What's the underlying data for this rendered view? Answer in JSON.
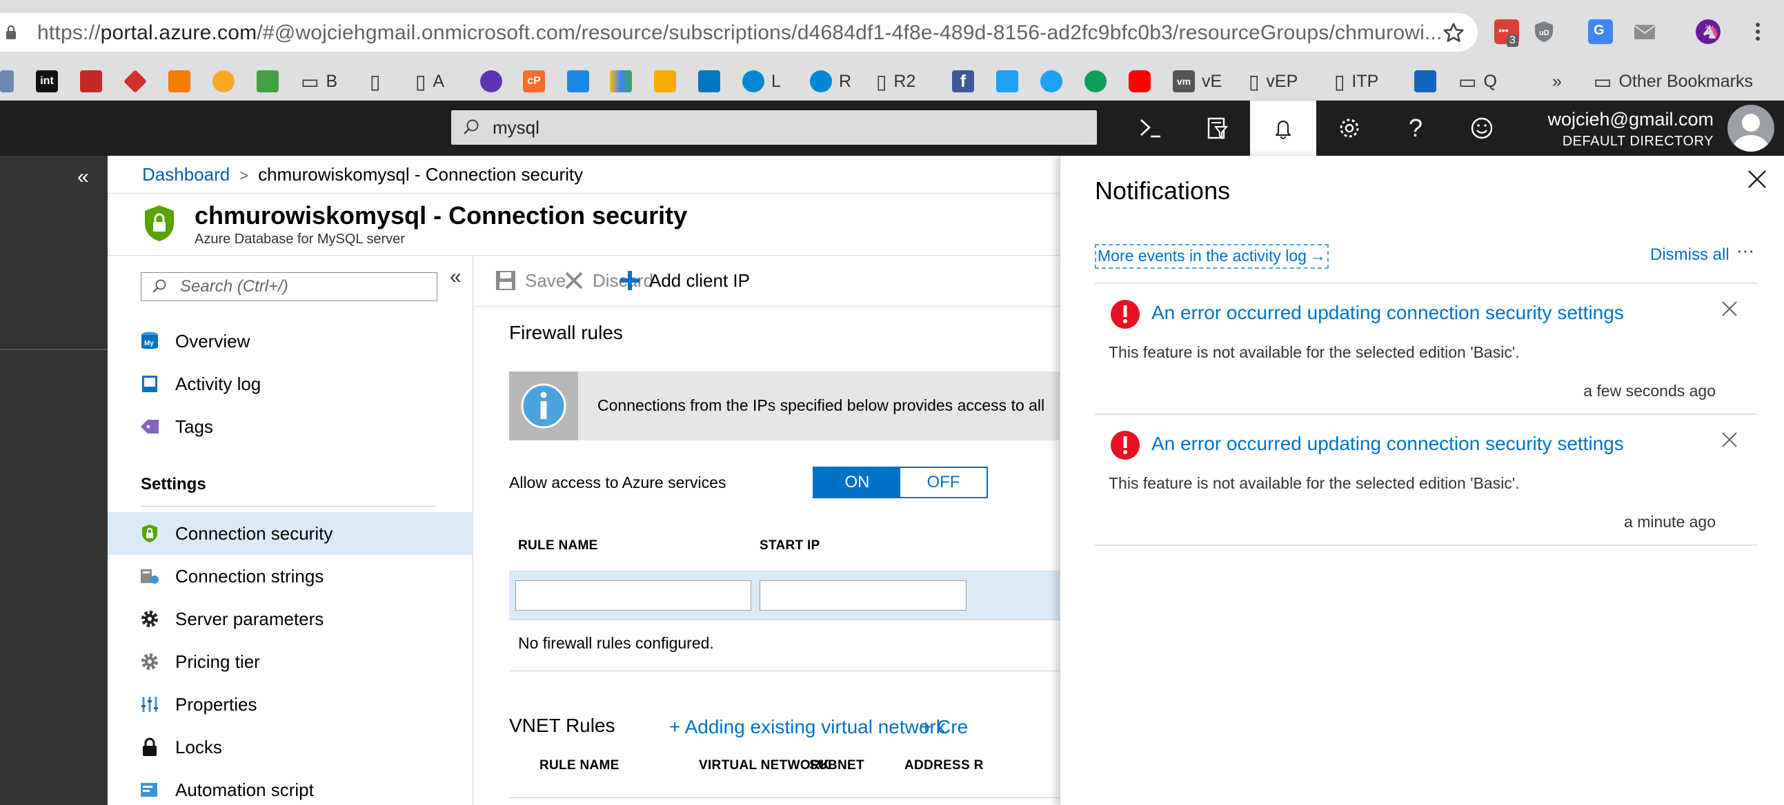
{
  "browser": {
    "url_prefix": "https://",
    "url_host": "portal.azure.com",
    "url_rest": "/#@wojciehgmail.onmicrosoft.com/resource/subscriptions/d4684df1-4f8e-489d-8156-ad2fc9bfc0b3/resourceGroups/chmurowi...",
    "extension_badge": "3",
    "bookmarks": {
      "b": "B",
      "a": "A",
      "l": "L",
      "r": "R",
      "r2": "R2",
      "ve": "vE",
      "vep": "vEP",
      "itp": "ITP",
      "q": "Q",
      "overflow": "»",
      "other": "Other Bookmarks"
    }
  },
  "topbar": {
    "search_value": "mysql",
    "account_email": "wojcieh@gmail.com",
    "account_directory": "DEFAULT DIRECTORY"
  },
  "breadcrumb": {
    "root": "Dashboard",
    "separator": ">",
    "current": "chmurowiskomysql - Connection security"
  },
  "page": {
    "title": "chmurowiskomysql - Connection security",
    "subtitle": "Azure Database for MySQL server"
  },
  "menu": {
    "search_placeholder": "Search (Ctrl+/)",
    "collapse": "«",
    "items_top": [
      {
        "label": "Overview",
        "icon": "mysql-server-icon"
      },
      {
        "label": "Activity log",
        "icon": "activity-log-icon"
      },
      {
        "label": "Tags",
        "icon": "tag-icon"
      }
    ],
    "settings_header": "Settings",
    "settings_items": [
      {
        "label": "Connection security",
        "icon": "shield-icon",
        "selected": true
      },
      {
        "label": "Connection strings",
        "icon": "connection-strings-icon"
      },
      {
        "label": "Server parameters",
        "icon": "gear-icon"
      },
      {
        "label": "Pricing tier",
        "icon": "pricing-gear-icon"
      },
      {
        "label": "Properties",
        "icon": "properties-icon"
      },
      {
        "label": "Locks",
        "icon": "lock-icon"
      },
      {
        "label": "Automation script",
        "icon": "automation-script-icon"
      }
    ]
  },
  "commands": {
    "save": "Save",
    "discard": "Discard",
    "add_client_ip": "Add client IP"
  },
  "firewall": {
    "title": "Firewall rules",
    "info_text": "Connections from the IPs specified below provides access to all",
    "azure_access_label": "Allow access to Azure services",
    "toggle_on": "ON",
    "toggle_off": "OFF",
    "toggle_value": "ON",
    "col_rule_name": "RULE NAME",
    "col_start_ip": "START IP",
    "rule_name_value": "",
    "start_ip_value": "",
    "empty_text": "No firewall rules configured."
  },
  "vnet": {
    "title": "VNET Rules",
    "add_existing": "+ Adding existing virtual network",
    "create_new": "+ Cre",
    "col_rule_name": "RULE NAME",
    "col_virtual_network": "VIRTUAL NETWORK",
    "col_subnet": "SUBNET",
    "col_address": "ADDRESS R"
  },
  "notifications": {
    "title": "Notifications",
    "activity_link": "More events in the activity log",
    "activity_arrow": "→",
    "dismiss_all": "Dismiss all",
    "more": "···",
    "items": [
      {
        "title": "An error occurred updating connection security settings",
        "body": "This feature is not available for the selected edition 'Basic'.",
        "time": "a few seconds ago"
      },
      {
        "title": "An error occurred updating connection security settings",
        "body": "This feature is not available for the selected edition 'Basic'.",
        "time": "a minute ago"
      }
    ]
  },
  "colors": {
    "azure_blue": "#0072c6",
    "error_red": "#e81123",
    "selected_bg": "#dbeaf7",
    "topbar_bg": "#1e1e1e"
  }
}
